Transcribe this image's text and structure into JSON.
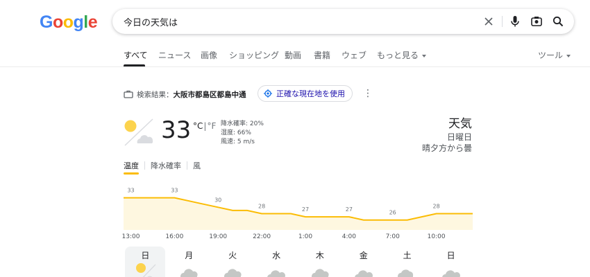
{
  "logo": {
    "letters": [
      "G",
      "o",
      "o",
      "g",
      "l",
      "e"
    ],
    "colors": [
      "#4285f4",
      "#ea4335",
      "#fbbc05",
      "#4285f4",
      "#34a853",
      "#ea4335"
    ]
  },
  "search": {
    "query": "今日の天気は",
    "icons": [
      "close-icon",
      "mic-icon",
      "lens-icon",
      "search-icon"
    ]
  },
  "tabs": [
    {
      "label": "すべて",
      "active": true
    },
    {
      "label": "ニュース"
    },
    {
      "label": "画像"
    },
    {
      "label": "ショッピング"
    },
    {
      "label": "動画"
    },
    {
      "label": "書籍"
    },
    {
      "label": "ウェブ"
    },
    {
      "label": "もっと見る",
      "dropdown": true
    }
  ],
  "tools_label": "ツール",
  "location": {
    "prefix": "検索結果：",
    "place": "大阪市都島区都島中通",
    "precise_button": "正確な現在地を使用"
  },
  "current": {
    "temp": "33",
    "unit_c": "°C",
    "unit_f": "°F",
    "precip": "降水確率: 20%",
    "humidity": "湿度: 66%",
    "wind": "風速: 5 m/s",
    "title": "天気",
    "day": "日曜日",
    "condition": "晴夕方から曇"
  },
  "metric_tabs": [
    "温度",
    "降水確率",
    "風"
  ],
  "colors": {
    "accent": "#fbbc04",
    "fill": "#fef7e0",
    "link": "#1a0dab"
  },
  "chart_data": {
    "type": "area",
    "x": [
      "13:00",
      "14:00",
      "15:00",
      "16:00",
      "17:00",
      "18:00",
      "19:00",
      "20:00",
      "21:00",
      "22:00",
      "23:00",
      "0:00",
      "1:00",
      "2:00",
      "3:00",
      "4:00",
      "5:00",
      "6:00",
      "7:00",
      "8:00",
      "9:00",
      "10:00",
      "11:00",
      "12:00"
    ],
    "values": [
      33,
      33,
      33,
      33,
      32,
      31,
      30,
      29,
      29,
      28,
      28,
      28,
      27,
      27,
      27,
      27,
      26,
      26,
      26,
      26,
      27,
      28,
      28,
      28
    ],
    "labels_shown": [
      {
        "x": "13:00",
        "value": 33
      },
      {
        "x": "16:00",
        "value": 33
      },
      {
        "x": "19:00",
        "value": 30
      },
      {
        "x": "22:00",
        "value": 28
      },
      {
        "x": "1:00",
        "value": 27
      },
      {
        "x": "4:00",
        "value": 27
      },
      {
        "x": "7:00",
        "value": 26
      },
      {
        "x": "10:00",
        "value": 28
      }
    ],
    "tick_labels": [
      "13:00",
      "16:00",
      "19:00",
      "22:00",
      "1:00",
      "4:00",
      "7:00",
      "10:00"
    ]
  },
  "days": [
    {
      "label": "日",
      "icon": "sun-cloud-icon",
      "selected": true
    },
    {
      "label": "月",
      "icon": "rain-cloud-icon"
    },
    {
      "label": "火",
      "icon": "rain-cloud-icon"
    },
    {
      "label": "水",
      "icon": "cloud-icon"
    },
    {
      "label": "木",
      "icon": "rain-cloud-icon"
    },
    {
      "label": "金",
      "icon": "cloud-icon"
    },
    {
      "label": "土",
      "icon": "cloud-sun-icon"
    },
    {
      "label": "日",
      "icon": "cloud-icon"
    }
  ]
}
